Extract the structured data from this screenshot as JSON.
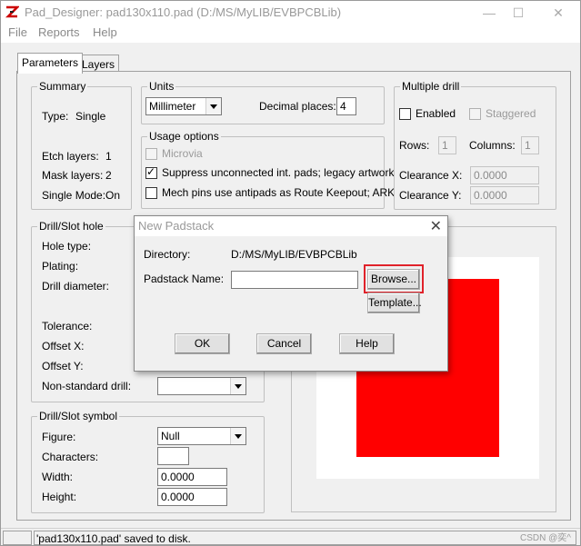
{
  "window": {
    "title": "Pad_Designer: pad130x110.pad (D:/MS/MyLIB/EVBPCBLib)",
    "minimize": "—",
    "maximize": "☐",
    "close": "✕"
  },
  "menu": [
    "File",
    "Reports",
    "Help"
  ],
  "tabs": [
    "Parameters",
    "Layers"
  ],
  "summary": {
    "label": "Summary",
    "type_label": "Type:",
    "type_value": "Single",
    "etch_label": "Etch layers:",
    "etch_value": "1",
    "mask_label": "Mask layers:",
    "mask_value": "2",
    "single_label": "Single Mode:",
    "single_value": "On"
  },
  "units": {
    "label": "Units",
    "value": "Millimeter",
    "decimal_label": "Decimal places:",
    "decimal_value": "4"
  },
  "usage": {
    "label": "Usage options",
    "microvia": "Microvia",
    "suppress": "Suppress unconnected int. pads; legacy artwork",
    "mech": "Mech pins use antipads as Route Keepout; ARK"
  },
  "multiple_drill": {
    "label": "Multiple drill",
    "enabled": "Enabled",
    "staggered": "Staggered",
    "rows_label": "Rows:",
    "rows_value": "1",
    "columns_label": "Columns:",
    "columns_value": "1",
    "clearance_x_label": "Clearance X:",
    "clearance_x_value": "0.0000",
    "clearance_y_label": "Clearance Y:",
    "clearance_y_value": "0.0000"
  },
  "drill_hole": {
    "label": "Drill/Slot hole",
    "hole_type": "Hole type:",
    "plating": "Plating:",
    "drill_diameter": "Drill diameter:",
    "tolerance": "Tolerance:",
    "offset_x": "Offset X:",
    "offset_y": "Offset Y:",
    "nonstandard": "Non-standard drill:"
  },
  "drill_symbol": {
    "label": "Drill/Slot symbol",
    "figure_label": "Figure:",
    "figure_value": "Null",
    "characters_label": "Characters:",
    "width_label": "Width:",
    "width_value": "0.0000",
    "height_label": "Height:",
    "height_value": "0.0000"
  },
  "dialog": {
    "title": "New Padstack",
    "close": "✕",
    "directory_label": "Directory:",
    "directory_value": "D:/MS/MyLIB/EVBPCBLib",
    "padstack_label": "Padstack Name:",
    "padstack_value": "",
    "browse": "Browse...",
    "template": "Template...",
    "ok": "OK",
    "cancel": "Cancel",
    "help": "Help"
  },
  "status": {
    "message": "'pad130x110.pad' saved to disk."
  },
  "watermark": "CSDN @奕^",
  "colors": {
    "pad_fill": "#ff0000",
    "highlight": "#e0222a"
  }
}
